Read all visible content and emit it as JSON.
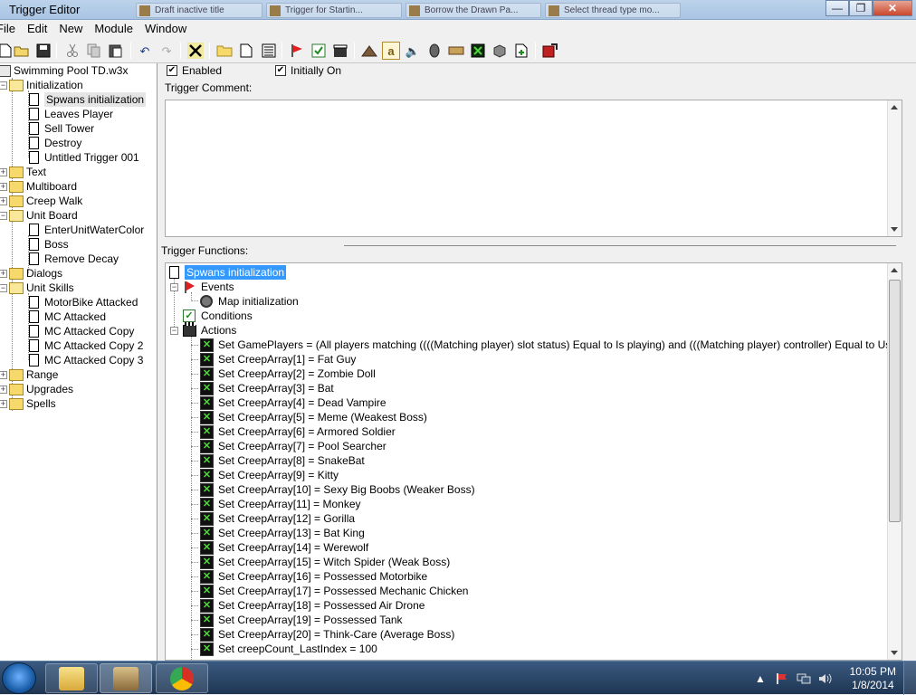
{
  "window": {
    "title": "Trigger Editor",
    "background_tabs": [
      "Draft inactive title",
      "Trigger for Startin...",
      "Borrow the Drawn Pa...",
      "Select thread type mo..."
    ]
  },
  "window_buttons": {
    "minimize": "—",
    "restore": "❐",
    "close": "✕"
  },
  "menu": [
    "File",
    "Edit",
    "New",
    "Module",
    "Window"
  ],
  "toolbar_icons": [
    "new-icon",
    "open-icon",
    "save-icon",
    "cut-icon",
    "copy-icon",
    "paste-icon",
    "undo-icon",
    "redo-icon",
    "delete-icon",
    "new-category-icon",
    "new-trigger-icon",
    "new-comment-icon",
    "new-event-icon",
    "new-condition-icon",
    "new-action-icon",
    "terrain-icon",
    "object-icon",
    "sound-icon",
    "ai-icon",
    "campaign-icon",
    "script-icon",
    "test-map-icon",
    "import-icon",
    "test-icon"
  ],
  "left_tree": {
    "root": "Swimming Pool TD.w3x",
    "nodes": [
      {
        "label": "Initialization",
        "type": "folder",
        "open": true,
        "level": 1
      },
      {
        "label": "Spwans initialization",
        "type": "doc",
        "level": 2,
        "selected": true
      },
      {
        "label": "Leaves Player",
        "type": "doc",
        "level": 2
      },
      {
        "label": "Sell Tower",
        "type": "doc",
        "level": 2
      },
      {
        "label": "Destroy",
        "type": "doc",
        "level": 2
      },
      {
        "label": "Untitled Trigger 001",
        "type": "doc",
        "level": 2
      },
      {
        "label": "Text",
        "type": "folder",
        "level": 1
      },
      {
        "label": "Multiboard",
        "type": "folder",
        "level": 1
      },
      {
        "label": "Creep Walk",
        "type": "folder",
        "level": 1
      },
      {
        "label": "Unit Board",
        "type": "folder",
        "open": true,
        "level": 1
      },
      {
        "label": "EnterUnitWaterColor",
        "type": "doc",
        "level": 2
      },
      {
        "label": "Boss",
        "type": "doc",
        "level": 2
      },
      {
        "label": "Remove Decay",
        "type": "doc",
        "level": 2
      },
      {
        "label": "Dialogs",
        "type": "folder",
        "level": 1
      },
      {
        "label": "Unit Skills",
        "type": "folder",
        "open": true,
        "level": 1
      },
      {
        "label": "MotorBike Attacked",
        "type": "doc",
        "level": 2
      },
      {
        "label": "MC Attacked",
        "type": "doc",
        "level": 2
      },
      {
        "label": "MC Attacked Copy",
        "type": "doc",
        "level": 2
      },
      {
        "label": "MC Attacked Copy 2",
        "type": "doc",
        "level": 2
      },
      {
        "label": "MC Attacked Copy 3",
        "type": "doc",
        "level": 2
      },
      {
        "label": "Range",
        "type": "folder",
        "level": 1
      },
      {
        "label": "Upgrades",
        "type": "folder",
        "level": 1
      },
      {
        "label": "Spells",
        "type": "folder",
        "level": 1
      }
    ]
  },
  "options": {
    "enabled": "Enabled",
    "initially_on": "Initially On",
    "enabled_check": "✔",
    "initially_on_check": "✔"
  },
  "comment_label": "Trigger Comment:",
  "functions_label": "Trigger Functions:",
  "trigger": {
    "name": "Spwans initialization",
    "events_label": "Events",
    "events": [
      "Map initialization"
    ],
    "conditions_label": "Conditions",
    "actions_label": "Actions",
    "actions": [
      "Set GamePlayers = (All players matching ((((Matching player) slot status) Equal to Is playing) and (((Matching player) controller) Equal to User)))",
      "Set CreepArray[1] = Fat Guy",
      "Set CreepArray[2] = Zombie Doll",
      "Set CreepArray[3] = Bat",
      "Set CreepArray[4] = Dead Vampire",
      "Set CreepArray[5] = Meme (Weakest Boss)",
      "Set CreepArray[6] = Armored Soldier",
      "Set CreepArray[7] = Pool Searcher",
      "Set CreepArray[8] = SnakeBat",
      "Set CreepArray[9] = Kitty",
      "Set CreepArray[10] = Sexy Big Boobs (Weaker Boss)",
      "Set CreepArray[11] = Monkey",
      "Set CreepArray[12] = Gorilla",
      "Set CreepArray[13] = Bat King",
      "Set CreepArray[14] = Werewolf",
      "Set CreepArray[15] = Witch Spider (Weak Boss)",
      "Set CreepArray[16] = Possessed Motorbike",
      "Set CreepArray[17] = Possessed Mechanic Chicken",
      "Set CreepArray[18] = Possessed Air Drone",
      "Set CreepArray[19] = Possessed Tank",
      "Set CreepArray[20] = Think-Care (Average Boss)",
      "Set creepCount_LastIndex = 100"
    ]
  },
  "expander_minus": "−",
  "expander_plus": "+",
  "taskbar": {
    "clock_time": "10:05 PM",
    "clock_date": "1/8/2014",
    "tray_arrow": "▲",
    "tray_icons": [
      "action-center-icon",
      "network-icon",
      "volume-icon"
    ]
  }
}
